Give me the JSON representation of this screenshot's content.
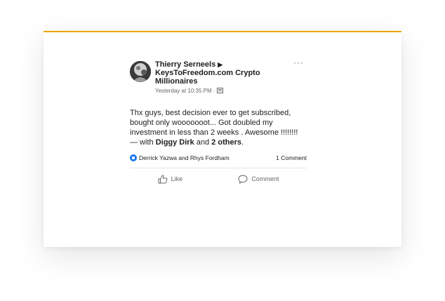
{
  "post": {
    "author": "Thierry Serneels",
    "arrow": "▶",
    "group": "KeysToFreedom.com Crypto Millionaires",
    "timestamp": "Yesterday at 10:35 PM ·",
    "more": "···",
    "text_main": "Thx guys, best decision ever to get subscribed, bought only wooooooot... Got doubled my investment in less than 2 weeks . Awesome !!!!!!!! — with ",
    "tag_person": "Diggy Dirk",
    "tag_and": " and ",
    "tag_others": "2 others",
    "text_end": "."
  },
  "reactions": {
    "likers": "Derrick Yazwa and Rhys Fordham",
    "comments": "1 Comment"
  },
  "actions": {
    "like_label": "Like",
    "comment_label": "Comment"
  },
  "colors": {
    "accent_border": "#f0a500",
    "facebook_blue": "#1877f2",
    "secondary_text": "#65676b"
  }
}
